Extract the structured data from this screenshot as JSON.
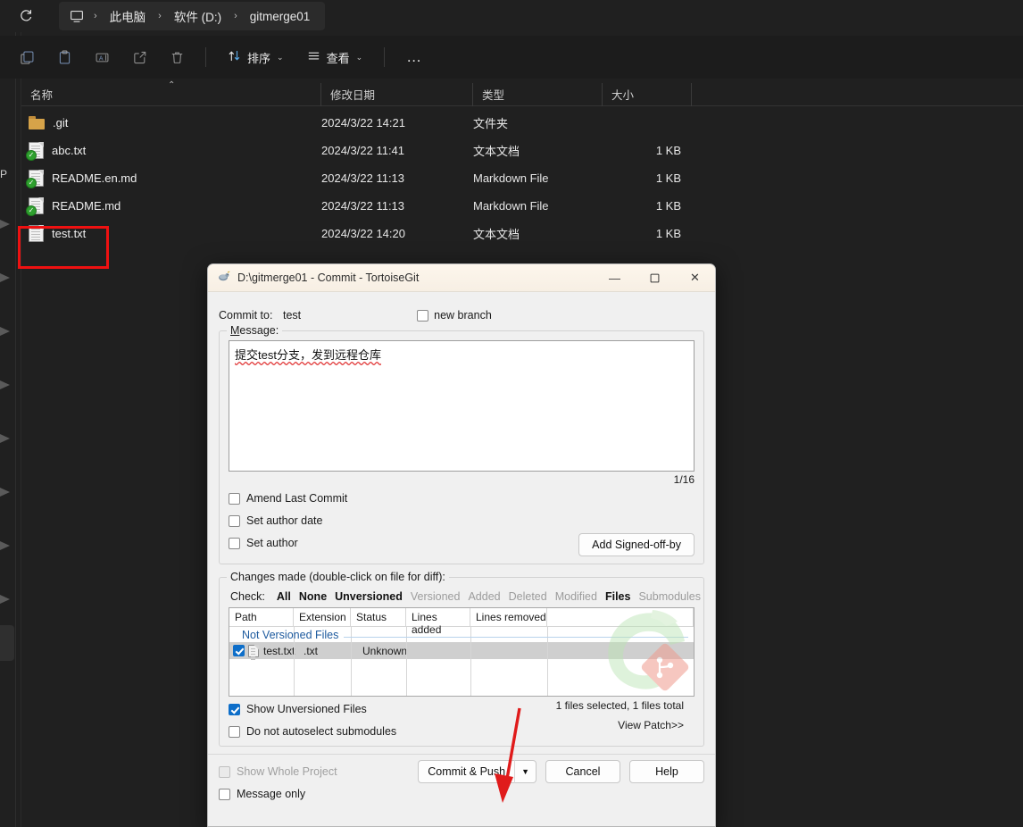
{
  "explorer": {
    "refresh_icon": "refresh-icon",
    "breadcrumb": {
      "pc_icon": "this-pc-icon",
      "items": [
        "此电脑",
        "软件 (D:)",
        "gitmerge01"
      ],
      "separator": "›"
    },
    "toolbar": {
      "icons": [
        "copy-icon",
        "paste-icon",
        "rename-icon",
        "share-icon",
        "delete-icon"
      ],
      "sort_label": "排序",
      "view_label": "查看",
      "more_label": "…",
      "sort_icon": "sort-arrows-icon",
      "view_icon": "list-lines-icon"
    },
    "columns": [
      {
        "label": "名称"
      },
      {
        "label": "修改日期"
      },
      {
        "label": "类型"
      },
      {
        "label": "大小"
      }
    ],
    "files": [
      {
        "name": ".git",
        "icon": "folder-icon",
        "date": "2024/3/22 14:21",
        "type": "文件夹",
        "size": ""
      },
      {
        "name": "abc.txt",
        "icon": "file-ok-icon",
        "date": "2024/3/22 11:41",
        "type": "文本文档",
        "size": "1 KB"
      },
      {
        "name": "README.en.md",
        "icon": "file-ok-icon",
        "date": "2024/3/22 11:13",
        "type": "Markdown File",
        "size": "1 KB"
      },
      {
        "name": "README.md",
        "icon": "file-ok-icon",
        "date": "2024/3/22 11:13",
        "type": "Markdown File",
        "size": "1 KB"
      },
      {
        "name": "test.txt",
        "icon": "file-icon",
        "date": "2024/3/22 14:20",
        "type": "文本文档",
        "size": "1 KB"
      }
    ],
    "nav_label": "P"
  },
  "dialog": {
    "title": "D:\\gitmerge01 - Commit - TortoiseGit",
    "title_icon": "tortoisegit-icon",
    "window_buttons": {
      "minimize": "—",
      "maximize": "▢",
      "close": "✕"
    },
    "commit_to_label": "Commit to:",
    "commit_to_value": "test",
    "new_branch_label": "new branch",
    "new_branch_checked": false,
    "message_legend": "Message:",
    "message_text": "提交test分支，发到远程仓库",
    "char_count": "1/16",
    "options": [
      {
        "label": "Amend Last Commit",
        "checked": false
      },
      {
        "label": "Set author date",
        "checked": false
      },
      {
        "label": "Set author",
        "checked": false
      }
    ],
    "signed_off_button": "Add Signed-off-by",
    "changes_legend": "Changes made (double-click on file for diff):",
    "check_label": "Check:",
    "check_links": [
      {
        "label": "All",
        "dim": false
      },
      {
        "label": "None",
        "dim": false
      },
      {
        "label": "Unversioned",
        "dim": false
      },
      {
        "label": "Versioned",
        "dim": true
      },
      {
        "label": "Added",
        "dim": true
      },
      {
        "label": "Deleted",
        "dim": true
      },
      {
        "label": "Modified",
        "dim": true
      },
      {
        "label": "Files",
        "dim": false
      },
      {
        "label": "Submodules",
        "dim": true
      }
    ],
    "table": {
      "columns": [
        "Path",
        "Extension",
        "Status",
        "Lines added",
        "Lines removed"
      ],
      "group_label": "Not Versioned Files",
      "rows": [
        {
          "checked": true,
          "path": "test.txt",
          "extension": ".txt",
          "status": "Unknown",
          "lines_added": "",
          "lines_removed": ""
        }
      ],
      "watermark_icon": "tortoisegit-watermark"
    },
    "status_text": "1 files selected, 1 files total",
    "view_patch_link": "View Patch>>",
    "bottom_options": [
      {
        "label": "Show Unversioned Files",
        "checked": true,
        "disabled": false
      },
      {
        "label": "Do not autoselect submodules",
        "checked": false,
        "disabled": false
      },
      {
        "label": "Show Whole Project",
        "checked": false,
        "disabled": true
      },
      {
        "label": "Message only",
        "checked": false,
        "disabled": false
      }
    ],
    "buttons": {
      "commit": "Commit & Push",
      "commit_dropdown": "▼",
      "cancel": "Cancel",
      "help": "Help"
    }
  },
  "annotations": {
    "highlight_target": "test.txt",
    "highlight_color": "#ee1111",
    "arrow_color": "#e01b1b",
    "arrow_points_to": "Commit & Push"
  }
}
